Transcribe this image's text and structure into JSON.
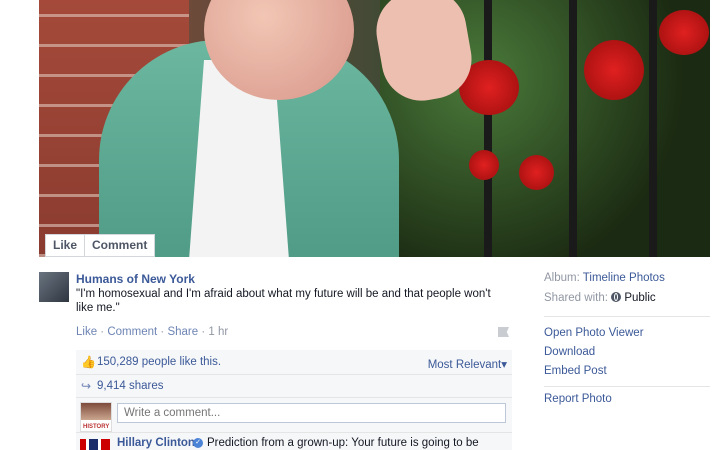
{
  "photo": {
    "like_label": "Like",
    "comment_label": "Comment"
  },
  "post": {
    "author": "Humans of New York",
    "caption": "\"I'm homosexual and I'm afraid about what my future will be and that people won't like me.\"",
    "actions": {
      "like": "Like",
      "comment": "Comment",
      "share": "Share",
      "time": "1 hr"
    }
  },
  "ufi": {
    "likes_text": "150,289 people like this.",
    "most_relevant": "Most Relevant",
    "shares_text": "9,414 shares",
    "comment_placeholder": "Write a comment...",
    "avatar_label": "HISTORY",
    "top_comment": {
      "name": "Hillary Clinton",
      "text": "Prediction from a grown-up: Your future is going to be"
    }
  },
  "sidebar": {
    "album_label": "Album:",
    "album_value": "Timeline Photos",
    "shared_label": "Shared with:",
    "shared_value": "Public",
    "open_viewer": "Open Photo Viewer",
    "download": "Download",
    "embed": "Embed Post",
    "report": "Report Photo"
  },
  "colors": {
    "link": "#3b5998",
    "muted": "#9197a3",
    "background": "#f6f7f9"
  },
  "icons": {
    "like": "thumbs-up-icon",
    "share": "share-arrow-icon",
    "flag": "flag-icon",
    "globe": "globe-icon",
    "verified": "verified-check-icon",
    "dropdown": "caret-down-icon"
  }
}
